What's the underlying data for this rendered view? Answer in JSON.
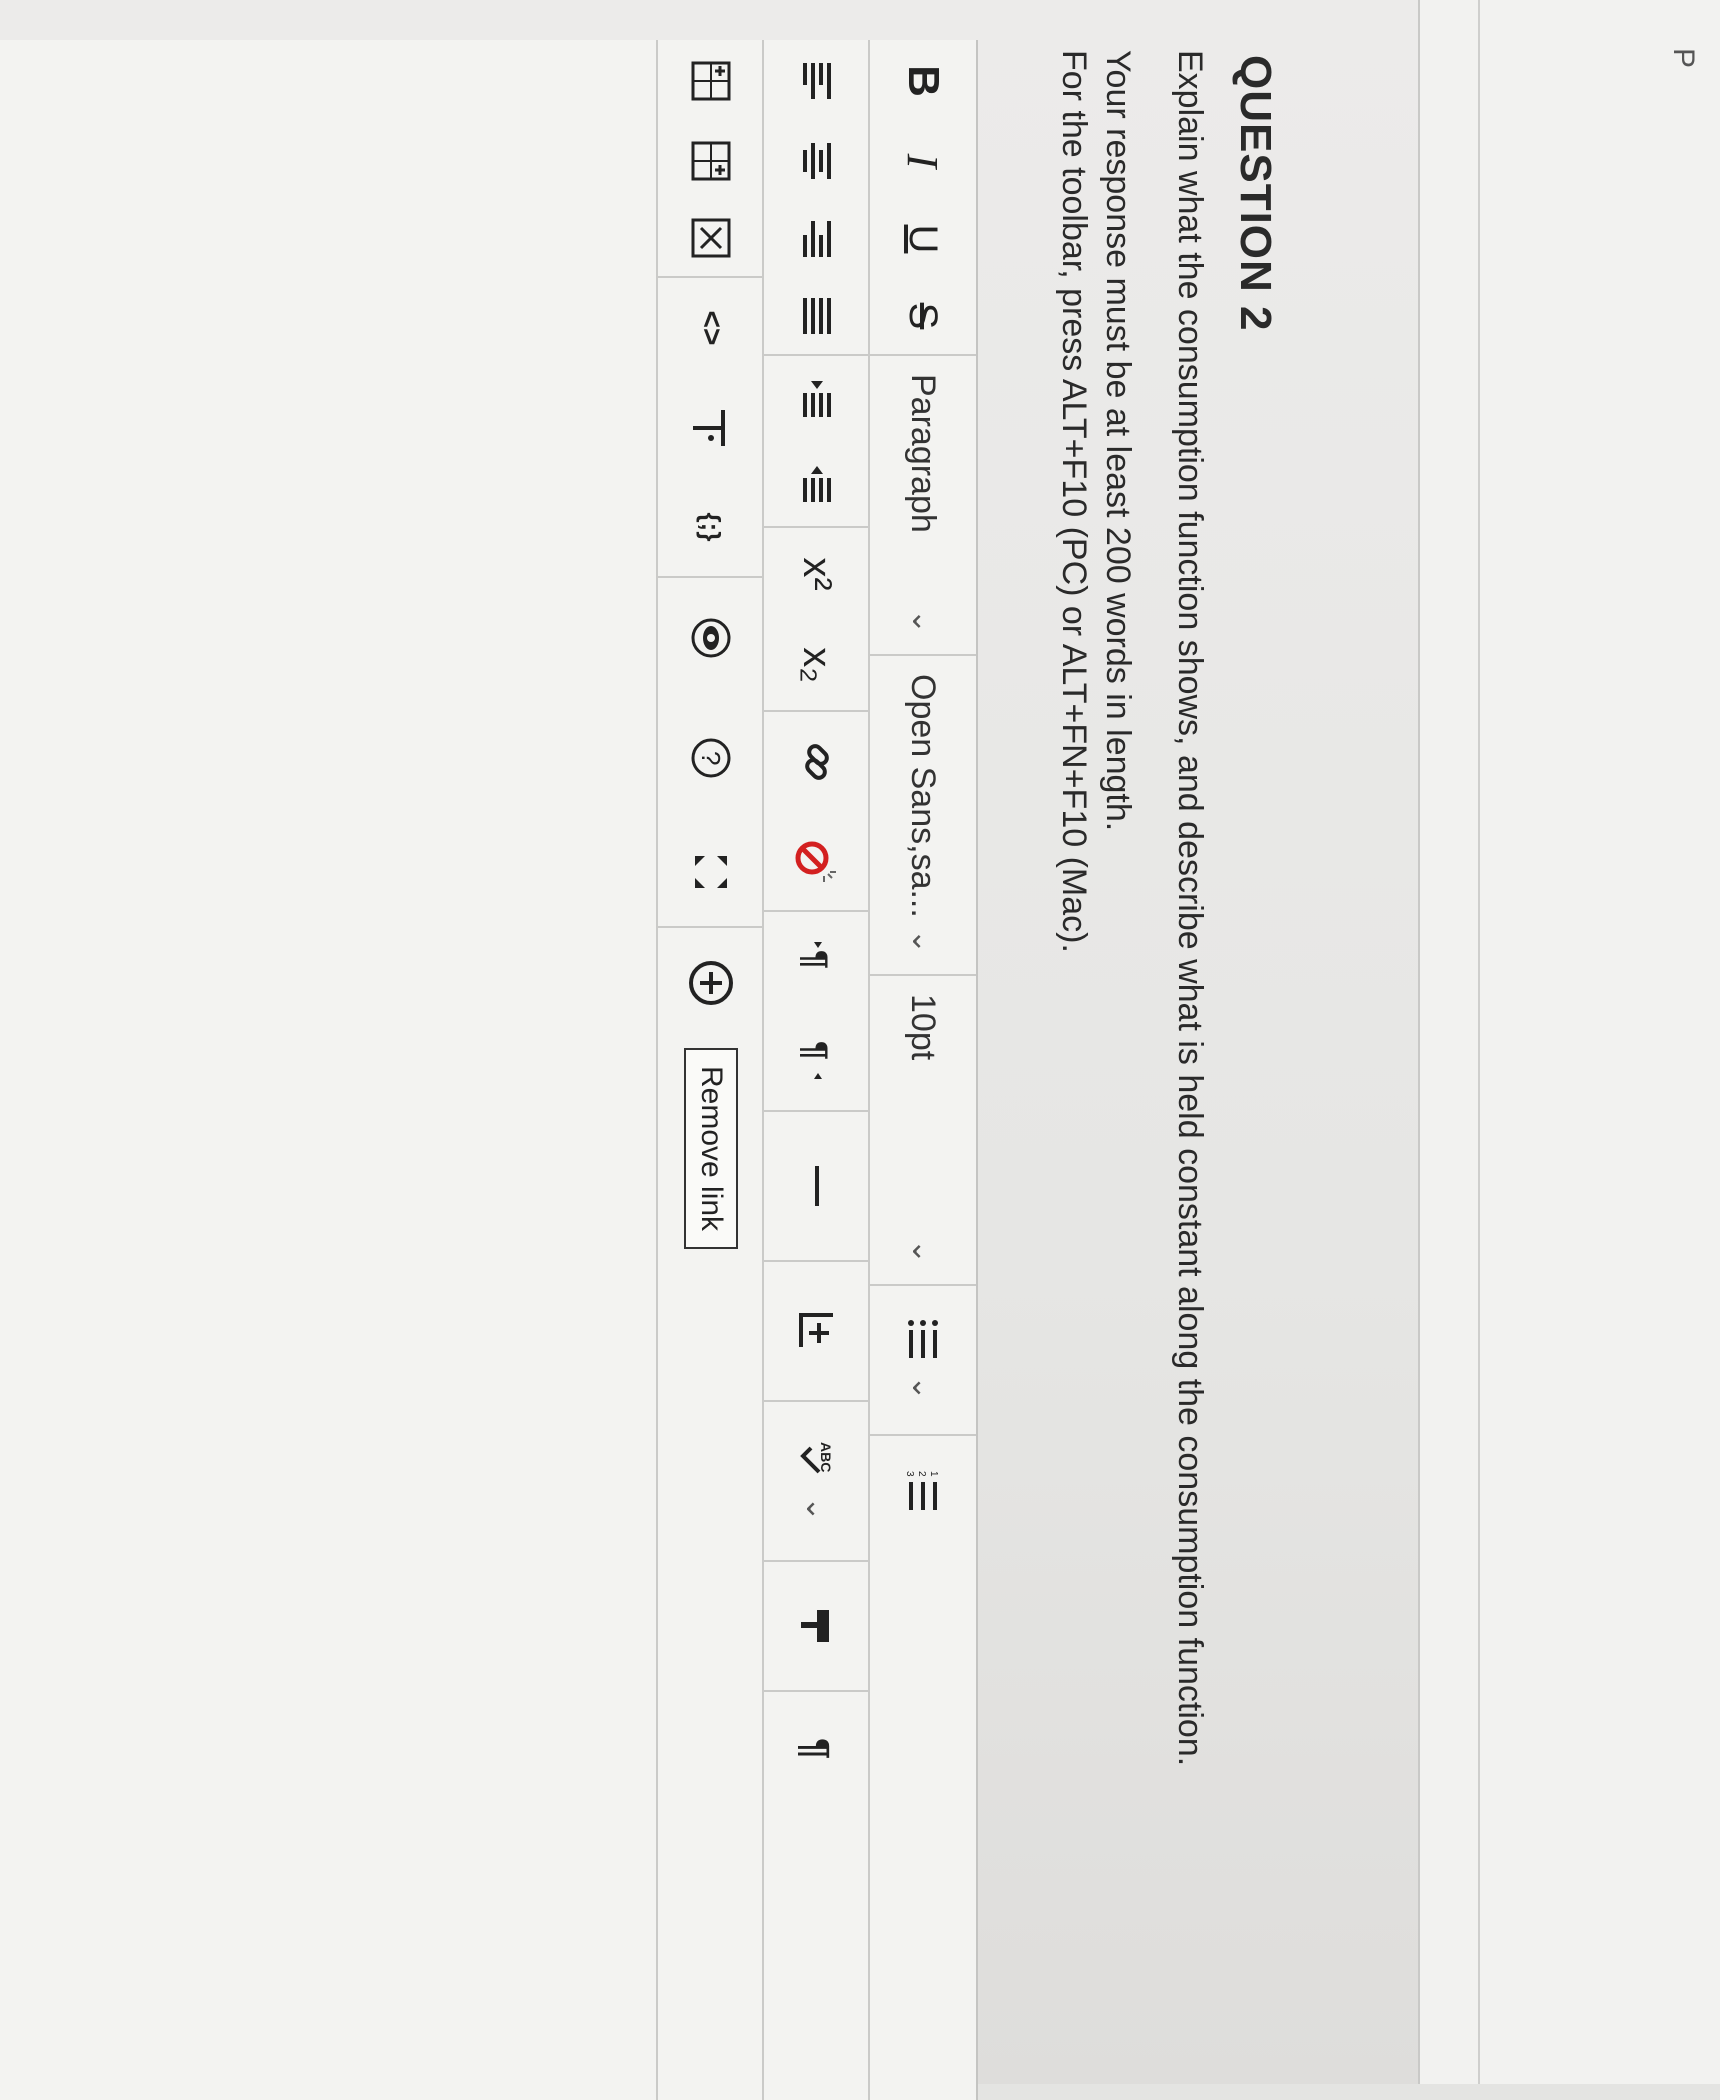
{
  "header": {
    "label": "P"
  },
  "question": {
    "title": "QUESTION 2",
    "prompt": "Explain what the consumption function shows, and describe what is held constant along the consumption function.",
    "requirement": "Your response must be at least 200 words in length.",
    "toolbar_hint": "For the toolbar, press ALT+F10 (PC) or ALT+FN+F10 (Mac)."
  },
  "toolbar": {
    "bold_label": "B",
    "italic_label": "I",
    "underline_label": "U",
    "strike_label": "S",
    "paragraph_select": "Paragraph",
    "font_select": "Open Sans,sa...",
    "size_select": "10pt",
    "superscript_label": "x²",
    "subscript_label": "x₂",
    "remove_link_tooltip": "Remove link",
    "code_label": "<>",
    "source_label": "{;}"
  },
  "colors": {
    "background": "#ecebea",
    "text": "#222222",
    "no_entry": "#d32020"
  }
}
